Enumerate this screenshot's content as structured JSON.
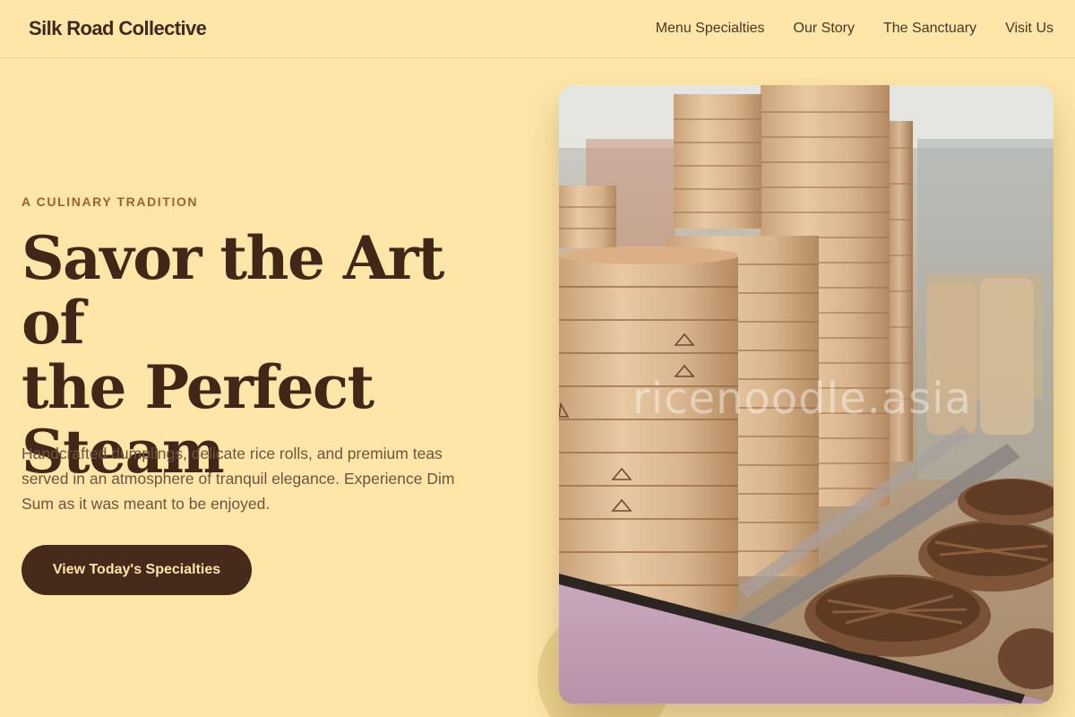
{
  "header": {
    "brand": "Silk Road Collective",
    "nav": [
      {
        "label": "Menu Specialties"
      },
      {
        "label": "Our Story"
      },
      {
        "label": "The Sanctuary"
      },
      {
        "label": "Visit Us"
      }
    ]
  },
  "hero": {
    "eyebrow": "A CULINARY TRADITION",
    "headline_lines": [
      "Savor the Art of",
      "the Perfect",
      "Steam"
    ],
    "subtext": "Handcrafted dumplings, delicate rice rolls, and premium teas served in an atmosphere of tranquil elegance. Experience Dim Sum as it was meant to be enjoyed.",
    "cta_label": "View Today's Specialties"
  },
  "photo": {
    "watermark": "ricenoodle.asia"
  },
  "colors": {
    "background": "#fde6a8",
    "text_dark": "#3f2a1d",
    "accent": "#a0602e",
    "button": "#462a1b"
  }
}
